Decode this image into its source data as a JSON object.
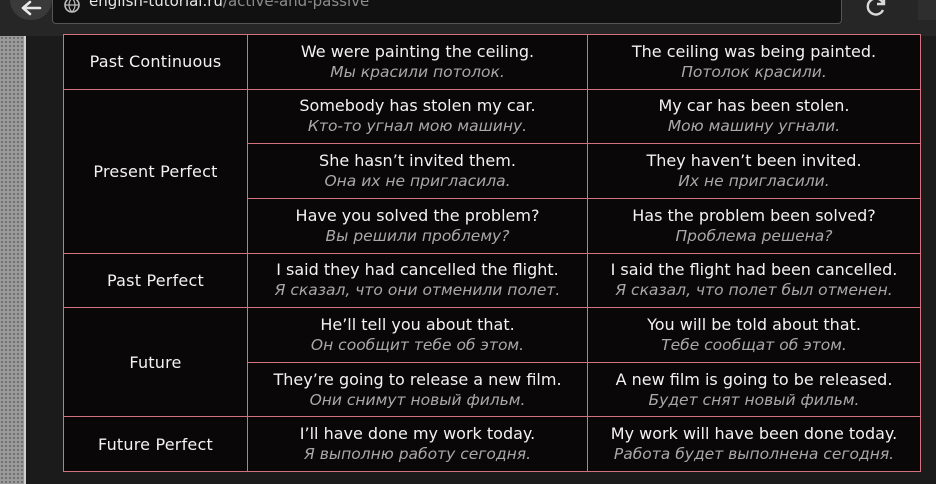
{
  "browser": {
    "url_host": "english-tutorial.ru",
    "url_path": "/active-and-passive"
  },
  "table": {
    "tenses": [
      {
        "name": "Past Continuous",
        "rows": [
          {
            "active": "We were painting the ceiling.",
            "active_ru": "Мы красили потолок.",
            "passive": "The ceiling was being painted.",
            "passive_ru": "Потолок красили."
          }
        ]
      },
      {
        "name": "Present Perfect",
        "rows": [
          {
            "active": "Somebody has stolen my car.",
            "active_ru": "Кто-то угнал мою машину.",
            "passive": "My car has been stolen.",
            "passive_ru": "Мою машину угнали."
          },
          {
            "active": "She hasn’t invited them.",
            "active_ru": "Она их не пригласила.",
            "passive": "They haven’t been invited.",
            "passive_ru": "Их не пригласили."
          },
          {
            "active": "Have you solved the problem?",
            "active_ru": "Вы решили проблему?",
            "passive": "Has the problem been solved?",
            "passive_ru": "Проблема решена?"
          }
        ]
      },
      {
        "name": "Past Perfect",
        "rows": [
          {
            "active": "I said they had cancelled the flight.",
            "active_ru": "Я сказал, что они отменили полет.",
            "passive": "I said the flight had been cancelled.",
            "passive_ru": "Я сказал, что полет был отменен."
          }
        ]
      },
      {
        "name": "Future",
        "rows": [
          {
            "active": "He’ll tell you about that.",
            "active_ru": "Он сообщит тебе об этом.",
            "passive": "You will be told about that.",
            "passive_ru": "Тебе сообщат об этом."
          },
          {
            "active": "They’re going to release a new film.",
            "active_ru": "Они снимут новый фильм.",
            "passive": "A new film is going to be released.",
            "passive_ru": "Будет снят новый фильм."
          }
        ]
      },
      {
        "name": "Future Perfect",
        "rows": [
          {
            "active": "I’ll have done my work today.",
            "active_ru": "Я выполню работу сегодня.",
            "passive": "My work will have been done today.",
            "passive_ru": "Работа будет выполнена сегодня."
          }
        ]
      }
    ]
  }
}
